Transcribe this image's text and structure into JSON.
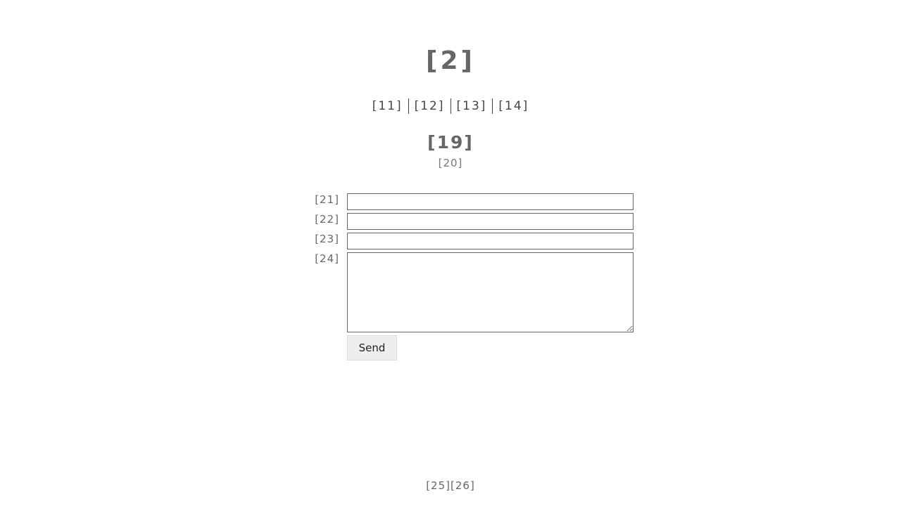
{
  "site": {
    "title": "[2]"
  },
  "nav": {
    "items": [
      {
        "label": "[11]"
      },
      {
        "label": "[12]"
      },
      {
        "label": "[13]"
      },
      {
        "label": "[14]"
      }
    ]
  },
  "contact": {
    "title": "[19]",
    "subtitle": "[20]",
    "fields": {
      "field1_label": "[21]",
      "field1_value": "",
      "field2_label": "[22]",
      "field2_value": "",
      "field3_label": "[23]",
      "field3_value": "",
      "message_label": "[24]",
      "message_value": ""
    },
    "send_label": "Send"
  },
  "footer": {
    "link1": "[25]",
    "link2": "[26]"
  }
}
